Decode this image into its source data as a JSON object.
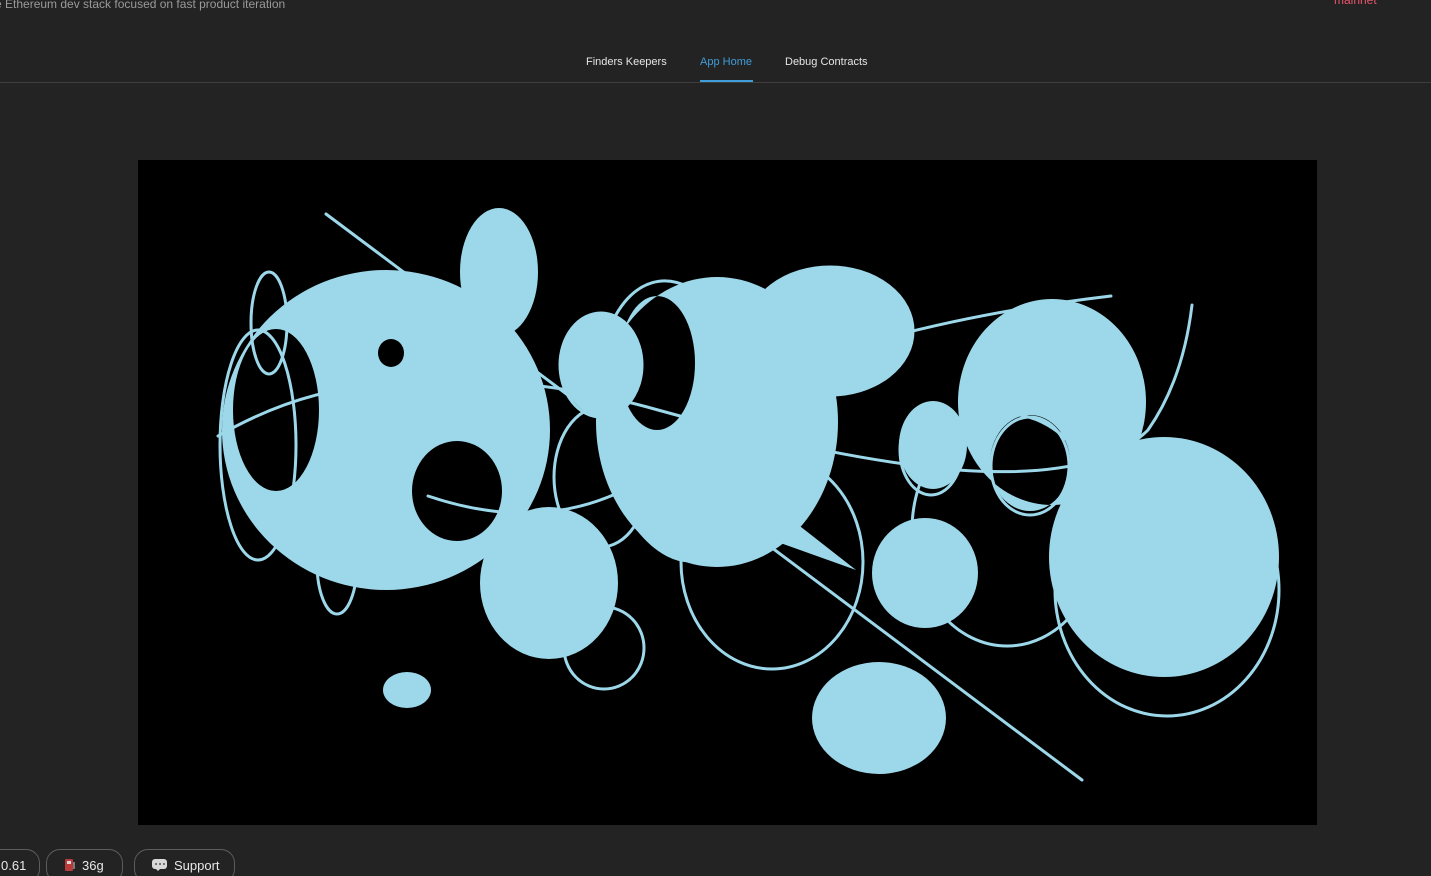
{
  "header": {
    "tagline": "e Ethereum dev stack focused on fast product iteration",
    "network": "mainnet"
  },
  "tabs": [
    {
      "label": "Finders Keepers",
      "active": false
    },
    {
      "label": "App Home",
      "active": true
    },
    {
      "label": "Debug Contracts",
      "active": false
    }
  ],
  "canvas": {
    "background": "#000000",
    "shape_color": "#9cd8ea"
  },
  "footer": {
    "price": "0.61",
    "gas": "36g",
    "support": "Support",
    "gas_icon": "gas-pump-icon",
    "support_icon": "speech-bubble-icon"
  },
  "colors": {
    "background": "#232323",
    "accent": "#3f9dd9",
    "network": "#e8546a"
  }
}
